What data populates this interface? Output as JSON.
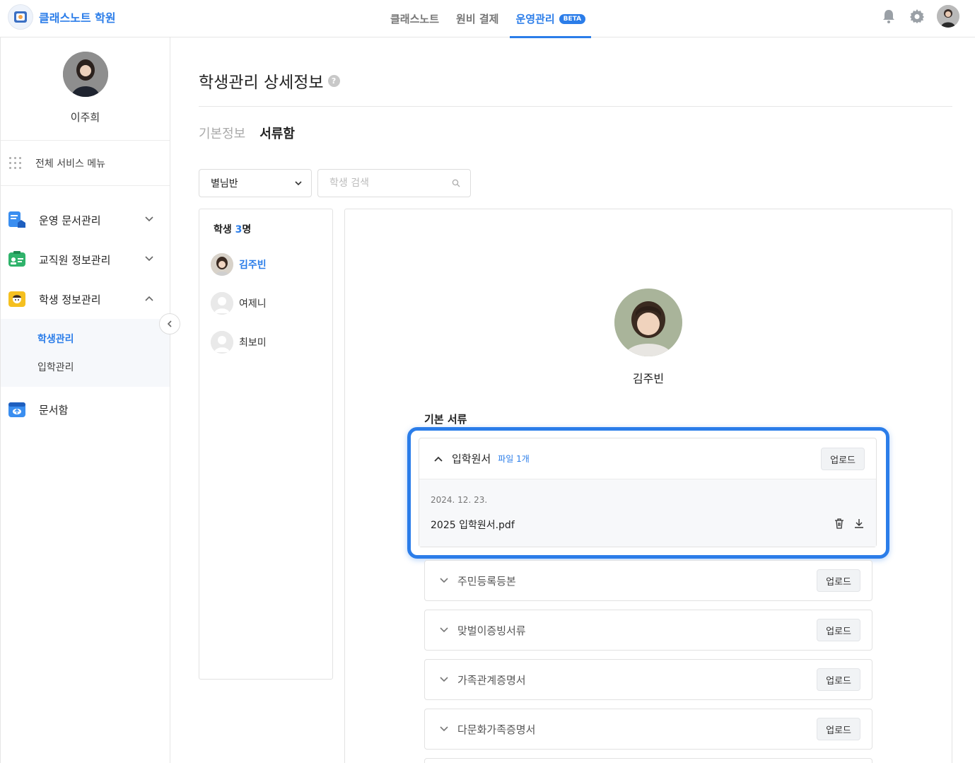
{
  "header": {
    "brand": "클래스노트 학원",
    "nav": [
      {
        "label": "클래스노트"
      },
      {
        "label": "원비 결제"
      },
      {
        "label": "운영관리",
        "badge": "BETA"
      }
    ]
  },
  "sidebar": {
    "user_name": "이주희",
    "all_menu": "전체 서비스 메뉴",
    "items": [
      {
        "label": "운영 문서관리",
        "icon": "document-icon",
        "color": "#3a8ef0"
      },
      {
        "label": "교직원 정보관리",
        "icon": "staff-card-icon",
        "color": "#2fb36b"
      },
      {
        "label": "학생 정보관리",
        "icon": "student-icon",
        "color": "#f5c020"
      },
      {
        "label": "문서함",
        "icon": "cloud-box-icon",
        "color": "#3a8ef0"
      }
    ],
    "submenu": [
      {
        "label": "학생관리"
      },
      {
        "label": "입학관리"
      }
    ]
  },
  "main": {
    "title": "학생관리 상세정보",
    "help": "?",
    "tabs": [
      {
        "label": "기본정보"
      },
      {
        "label": "서류함"
      }
    ],
    "class_select": "별님반",
    "search_placeholder": "학생 검색",
    "student_list": {
      "count_prefix": "학생 ",
      "count": "3",
      "count_suffix": "명",
      "students": [
        {
          "name": "김주빈"
        },
        {
          "name": "여제니"
        },
        {
          "name": "최보미"
        }
      ]
    },
    "detail": {
      "student_name": "김주빈",
      "section": "기본 서류",
      "open_doc": {
        "title": "입학원서",
        "file_count": "파일 1개",
        "upload": "업로드",
        "file_date": "2024. 12. 23.",
        "file_name": "2025 입학원서.pdf"
      },
      "docs": [
        {
          "title": "주민등록등본",
          "upload": "업로드"
        },
        {
          "title": "맞벌이증빙서류",
          "upload": "업로드"
        },
        {
          "title": "가족관계증명서",
          "upload": "업로드"
        },
        {
          "title": "다문화가족증명서",
          "upload": "업로드"
        }
      ]
    }
  },
  "colors": {
    "accent": "#2b7de9"
  }
}
